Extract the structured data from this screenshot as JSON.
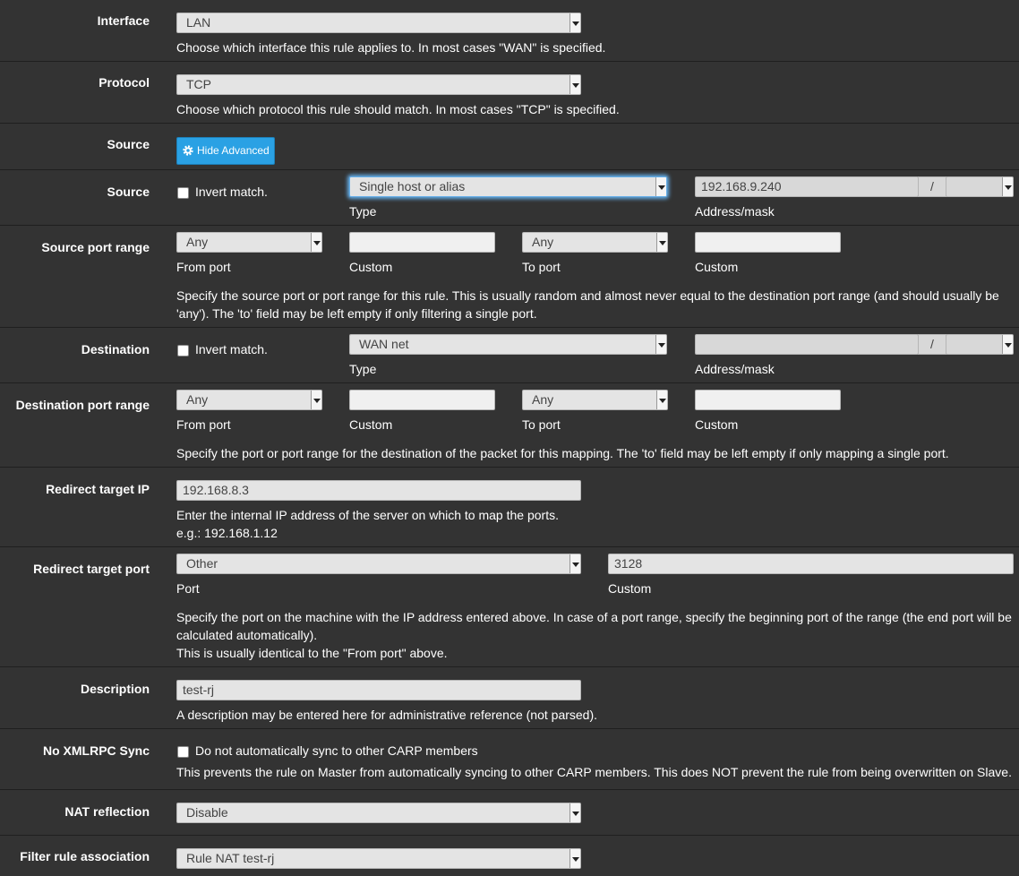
{
  "interface": {
    "label": "Interface",
    "value": "LAN",
    "help": "Choose which interface this rule applies to. In most cases \"WAN\" is specified."
  },
  "protocol": {
    "label": "Protocol",
    "value": "TCP",
    "help": "Choose which protocol this rule should match. In most cases \"TCP\" is specified."
  },
  "source_advanced": {
    "label": "Source",
    "button": "Hide Advanced"
  },
  "source": {
    "label": "Source",
    "invert_label": "Invert match.",
    "type_value": "Single host or alias",
    "type_caption": "Type",
    "address_value": "192.168.9.240",
    "slash": "/",
    "mask_value": "",
    "address_caption": "Address/mask"
  },
  "source_port": {
    "label": "Source port range",
    "from_value": "Any",
    "from_caption": "From port",
    "from_custom_caption": "Custom",
    "to_value": "Any",
    "to_caption": "To port",
    "to_custom_caption": "Custom",
    "help1": "Specify the source port or port range for this rule. This is usually random and almost never equal to the destination port range (and should usually be",
    "help2": "'any'). The 'to' field may be left empty if only filtering a single port."
  },
  "destination": {
    "label": "Destination",
    "invert_label": "Invert match.",
    "type_value": "WAN net",
    "type_caption": "Type",
    "address_value": "",
    "slash": "/",
    "address_caption": "Address/mask"
  },
  "dest_port": {
    "label": "Destination port range",
    "from_value": "Any",
    "from_caption": "From port",
    "from_custom_caption": "Custom",
    "to_value": "Any",
    "to_caption": "To port",
    "to_custom_caption": "Custom",
    "help": "Specify the port or port range for the destination of the packet for this mapping. The 'to' field may be left empty if only mapping a single port."
  },
  "redirect_ip": {
    "label": "Redirect target IP",
    "value": "192.168.8.3",
    "help1": "Enter the internal IP address of the server on which to map the ports.",
    "help2": "e.g.: 192.168.1.12"
  },
  "redirect_port": {
    "label": "Redirect target port",
    "port_value": "Other",
    "port_caption": "Port",
    "custom_value": "3128",
    "custom_caption": "Custom",
    "help1": "Specify the port on the machine with the IP address entered above. In case of a port range, specify the beginning port of the range (the end port will be",
    "help2": "calculated automatically).",
    "help3": "This is usually identical to the \"From port\" above."
  },
  "description": {
    "label": "Description",
    "value": "test-rj",
    "help": "A description may be entered here for administrative reference (not parsed)."
  },
  "xmlrpc": {
    "label": "No XMLRPC Sync",
    "checkbox_label": "Do not automatically sync to other CARP members",
    "help": "This prevents the rule on Master from automatically syncing to other CARP members. This does NOT prevent the rule from being overwritten on Slave."
  },
  "nat_reflection": {
    "label": "NAT reflection",
    "value": "Disable"
  },
  "filter_rule": {
    "label": "Filter rule association",
    "value": "Rule NAT test-rj"
  },
  "colors": {
    "background": "#333333",
    "button": "#2aa1e4",
    "field": "#e4e4e4"
  }
}
